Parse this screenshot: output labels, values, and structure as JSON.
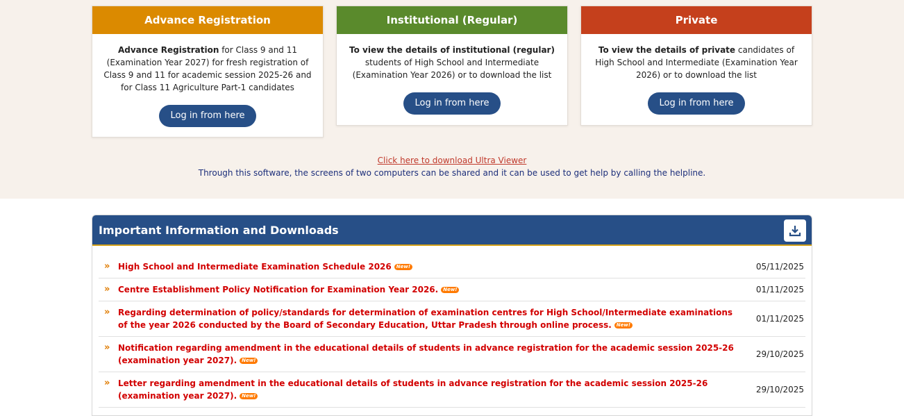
{
  "cards": {
    "advance": {
      "title": "Advance Registration",
      "bold": "Advance Registration",
      "text": " for Class 9 and 11 (Examination Year 2027) for fresh registration of Class 9 and 11 for academic session 2025-26 and for Class 11 Agriculture Part-1 candidates",
      "button": "Log in from here"
    },
    "institutional": {
      "title": "Institutional (Regular)",
      "bold": "To view the details of institutional (regular)",
      "text": " students of High School and Intermediate (Examination Year 2026) or to download the list",
      "button": "Log in from here"
    },
    "private": {
      "title": "Private",
      "bold": "To view the details of private",
      "text": " candidates of High School and Intermediate (Examination Year 2026) or to download the list",
      "button": "Log in from here"
    }
  },
  "ultra_viewer": {
    "link": "Click here to download Ultra Viewer",
    "note": "Through this software, the screens of two computers can be shared and it can be used to get help by calling the helpline."
  },
  "info": {
    "title": "Important Information and Downloads",
    "download_icon": "download-icon",
    "new_badge": "New!",
    "items": [
      {
        "text": "High School and Intermediate Examination Schedule 2026",
        "date": "05/11/2025"
      },
      {
        "text": "Centre Establishment Policy Notification for Examination Year 2026.",
        "date": "01/11/2025"
      },
      {
        "text": "Regarding determination of policy/standards for determination of examination centres for High School/Intermediate examinations of the year 2026 conducted by the Board of Secondary Education, Uttar Pradesh through online process.",
        "date": "01/11/2025"
      },
      {
        "text": "Notification regarding amendment in the educational details of students in advance registration for the academic session 2025-26 (examination year 2027).",
        "date": "29/10/2025"
      },
      {
        "text": "Letter regarding amendment in the educational details of students in advance registration for the academic session 2025-26 (examination year 2027).",
        "date": "29/10/2025"
      }
    ]
  },
  "colors": {
    "advance": "#db8a00",
    "institutional": "#5a8a2c",
    "private": "#c5401c",
    "primary": "#274f87",
    "item_text": "#d20000"
  }
}
